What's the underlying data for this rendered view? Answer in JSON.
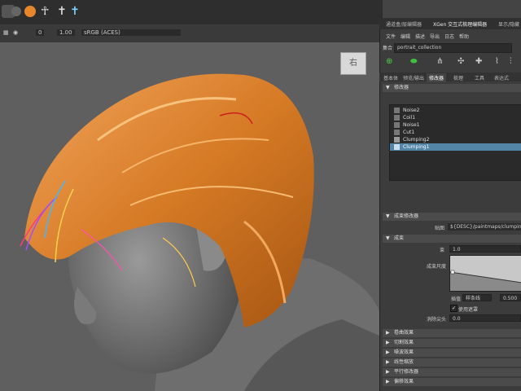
{
  "toolbar": {
    "frame_value": "0",
    "scale_value": "1.00",
    "colorspace": "sRGB (ACES)"
  },
  "viewport": {
    "corner_glyph": "右"
  },
  "panel": {
    "tabs": [
      "通道盒/层编辑器",
      "XGen 交互式梳理编辑器",
      "显示/隐藏"
    ],
    "menu": [
      "文件",
      "编辑",
      "描述",
      "导出",
      "日志",
      "帮助"
    ],
    "collection_label": "集合",
    "collection_value": "portrait_collection",
    "subtabs": [
      "基本体",
      "预览/输出",
      "修改器",
      "梳理",
      "工具",
      "表达式"
    ],
    "modifiers_section": "修改器",
    "modifiers": [
      "Noise2",
      "Coil1",
      "Noise1",
      "Cut1",
      "Clumping2",
      "Clumping1"
    ],
    "selected_modifier": "Clumping1",
    "clumping_section": "成束修改器",
    "map_label": "贴图",
    "map_value": "${DESC}/paintmaps/clumpin_n",
    "clump_section": "成束",
    "clump_field_label": "束",
    "clump_value": "1.0",
    "scale_label": "成束尺度",
    "interp_label": "插值",
    "interp_value": "样条线",
    "ramp_value": "0.500",
    "collision_label": "使用遮罩",
    "noise_label": "消除尖头",
    "noise_value": "0.0",
    "collapsed_sections": [
      "卷曲效果",
      "切割效果",
      "噪波效果",
      "线性缩放",
      "平行修改器",
      "偏移效果"
    ]
  },
  "colors": {
    "selected_row": "#5285a6",
    "hair": "#e38a2e"
  }
}
